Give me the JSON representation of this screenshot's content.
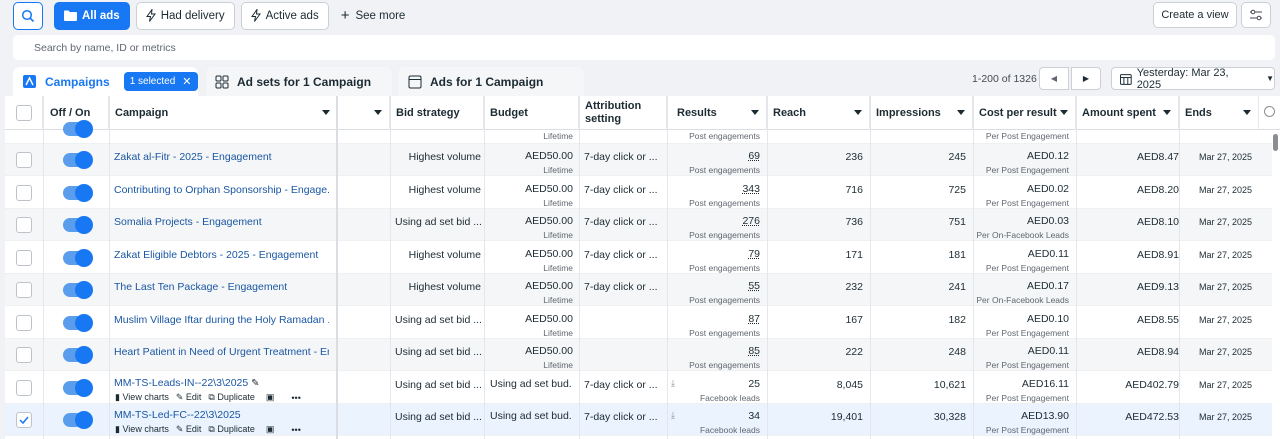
{
  "toolbar": {
    "filters": [
      "All ads",
      "Had delivery",
      "Active ads"
    ],
    "see_more": "See more",
    "create_view": "Create a view"
  },
  "search": {
    "placeholder": "Search by name, ID or metrics"
  },
  "tabs": {
    "campaigns": "Campaigns",
    "selected": "1 selected",
    "adsets": "Ad sets for 1 Campaign",
    "ads": "Ads for 1 Campaign"
  },
  "pager": {
    "range": "1-200 of 1326",
    "date": "Yesterday: Mar 23, 2025"
  },
  "columns": {
    "off_on": "Off / On",
    "campaign": "Campaign",
    "bid": "Bid strategy",
    "budget": "Budget",
    "attribution": "Attribution setting",
    "results": "Results",
    "reach": "Reach",
    "impressions": "Impressions",
    "cpr": "Cost per result",
    "amount": "Amount spent",
    "ends": "Ends"
  },
  "partial_row": {
    "budget_sub": "Lifetime",
    "results_sub": "Post engagements",
    "cpr_sub": "Per Post Engagement"
  },
  "rows": [
    {
      "name": "Zakat al-Fitr - 2025 - Engagement",
      "bid": "Highest volume",
      "budget": "AED50.00",
      "budget_sub": "Lifetime",
      "attr": "7-day click or ...",
      "results": "69",
      "results_sub": "Post engagements",
      "reach": "236",
      "impr": "245",
      "cpr": "AED0.12",
      "cpr_sub": "Per Post Engagement",
      "amt": "AED8.47",
      "ends": "Mar 27, 2025"
    },
    {
      "name": "Contributing to Orphan Sponsorship - Engage...",
      "bid": "Highest volume",
      "budget": "AED50.00",
      "budget_sub": "Lifetime",
      "attr": "7-day click or ...",
      "results": "343",
      "results_sub": "Post engagements",
      "reach": "716",
      "impr": "725",
      "cpr": "AED0.02",
      "cpr_sub": "Per Post Engagement",
      "amt": "AED8.20",
      "ends": "Mar 27, 2025"
    },
    {
      "name": "Somalia Projects - Engagement",
      "bid": "Using ad set bid ...",
      "budget": "AED50.00",
      "budget_sub": "Lifetime",
      "attr": "7-day click or ...",
      "results": "276",
      "results_sub": "Post engagements",
      "reach": "736",
      "impr": "751",
      "cpr": "AED0.03",
      "cpr_sub": "Per On-Facebook Leads",
      "amt": "AED8.10",
      "ends": "Mar 27, 2025"
    },
    {
      "name": "Zakat Eligible Debtors - 2025 - Engagement",
      "bid": "Highest volume",
      "budget": "AED50.00",
      "budget_sub": "Lifetime",
      "attr": "7-day click or ...",
      "results": "79",
      "results_sub": "Post engagements",
      "reach": "171",
      "impr": "181",
      "cpr": "AED0.11",
      "cpr_sub": "Per Post Engagement",
      "amt": "AED8.91",
      "ends": "Mar 27, 2025"
    },
    {
      "name": "The Last Ten Package - Engagement",
      "bid": "Highest volume",
      "budget": "AED50.00",
      "budget_sub": "Lifetime",
      "attr": "7-day click or ...",
      "results": "55",
      "results_sub": "Post engagements",
      "reach": "232",
      "impr": "241",
      "cpr": "AED0.17",
      "cpr_sub": "Per On-Facebook Leads",
      "amt": "AED9.13",
      "ends": "Mar 27, 2025"
    },
    {
      "name": "Muslim Village Iftar during the Holy Ramadan ...",
      "bid": "Using ad set bid ...",
      "budget": "AED50.00",
      "budget_sub": "Lifetime",
      "attr": "",
      "results": "87",
      "results_sub": "Post engagements",
      "reach": "167",
      "impr": "182",
      "cpr": "AED0.10",
      "cpr_sub": "Per Post Engagement",
      "amt": "AED8.55",
      "ends": "Mar 27, 2025"
    },
    {
      "name": "Heart Patient in Need of Urgent Treatment - En...",
      "bid": "Using ad set bid ...",
      "budget": "AED50.00",
      "budget_sub": "Lifetime",
      "attr": "",
      "results": "85",
      "results_sub": "Post engagements",
      "reach": "222",
      "impr": "248",
      "cpr": "AED0.11",
      "cpr_sub": "Per Post Engagement",
      "amt": "AED8.94",
      "ends": "Mar 27, 2025"
    },
    {
      "name": "MM-TS-Leads-IN--22\\3\\2025",
      "bid": "Using ad set bid ...",
      "budget": "Using ad set bud...",
      "budget_sub": "",
      "attr": "7-day click or ...",
      "results": "25",
      "results_sub": "Facebook leads",
      "reach": "8,045",
      "impr": "10,621",
      "cpr": "AED16.11",
      "cpr_sub": "Per Post Engagement",
      "amt": "AED402.79",
      "ends": "Mar 27, 2025"
    },
    {
      "name": "MM-TS-Led-FC--22\\3\\2025",
      "bid": "Using ad set bid ...",
      "budget": "Using ad set bud...",
      "budget_sub": "",
      "attr": "7-day click or ...",
      "results": "34",
      "results_sub": "Facebook leads",
      "reach": "19,401",
      "impr": "30,328",
      "cpr": "AED13.90",
      "cpr_sub": "Per Post Engagement",
      "amt": "AED472.53",
      "ends": "Mar 27, 2025"
    }
  ],
  "row_actions": {
    "view_charts": "View charts",
    "edit": "Edit",
    "duplicate": "Duplicate",
    "more": "•••"
  },
  "icons": {
    "search": "magnifier-icon",
    "folder": "folder-icon",
    "bolt": "bolt-icon",
    "plus": "plus-icon",
    "sliders": "sliders-icon",
    "calendar": "calendar-icon",
    "grid": "grid-icon",
    "window": "window-icon",
    "pencil": "pencil-icon",
    "check": "check-icon",
    "download": "download-icon"
  },
  "colors": {
    "accent": "#1877f2",
    "link": "#1a57a3",
    "toggle_track": "#5b9ded"
  }
}
